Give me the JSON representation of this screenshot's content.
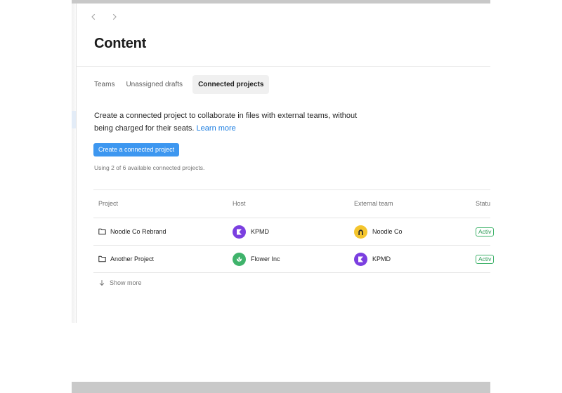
{
  "page": {
    "title": "Content"
  },
  "navigation": {
    "back_icon": "chevron-left-icon",
    "forward_icon": "chevron-right-icon"
  },
  "tabs": [
    {
      "label": "Teams",
      "active": false
    },
    {
      "label": "Unassigned drafts",
      "active": false
    },
    {
      "label": "Connected projects",
      "active": true
    }
  ],
  "intro": {
    "text_line1": "Create a connected project to collaborate in files with external teams, without",
    "text_line2": "being charged for their seats.",
    "learn_more": "Learn more"
  },
  "primary_action": {
    "label": "Create a connected project"
  },
  "usage": {
    "text": "Using 2 of 6 available connected projects."
  },
  "table": {
    "columns": [
      "Project",
      "Host",
      "External team",
      "Statu"
    ],
    "rows": [
      {
        "project": "Noodle Co Rebrand",
        "host": "KPMD",
        "host_logo": "kpmd-logo",
        "external_team": "Noodle Co",
        "external_logo": "noodle-co-logo",
        "status": "Activ"
      },
      {
        "project": "Another Project",
        "host": "Flower Inc",
        "host_logo": "flower-inc-logo",
        "external_team": "KPMD",
        "external_logo": "kpmd-logo",
        "status": "Activ"
      }
    ]
  },
  "show_more": {
    "label": "Show more",
    "icon": "arrow-down-icon"
  },
  "colors": {
    "accent": "#3d97f0",
    "link": "#1a7ce0",
    "status_green": "#3fb36b",
    "kpmd_purple": "#7b3fe0",
    "noodle_yellow": "#f4c52d",
    "flower_green": "#3fb36b"
  }
}
